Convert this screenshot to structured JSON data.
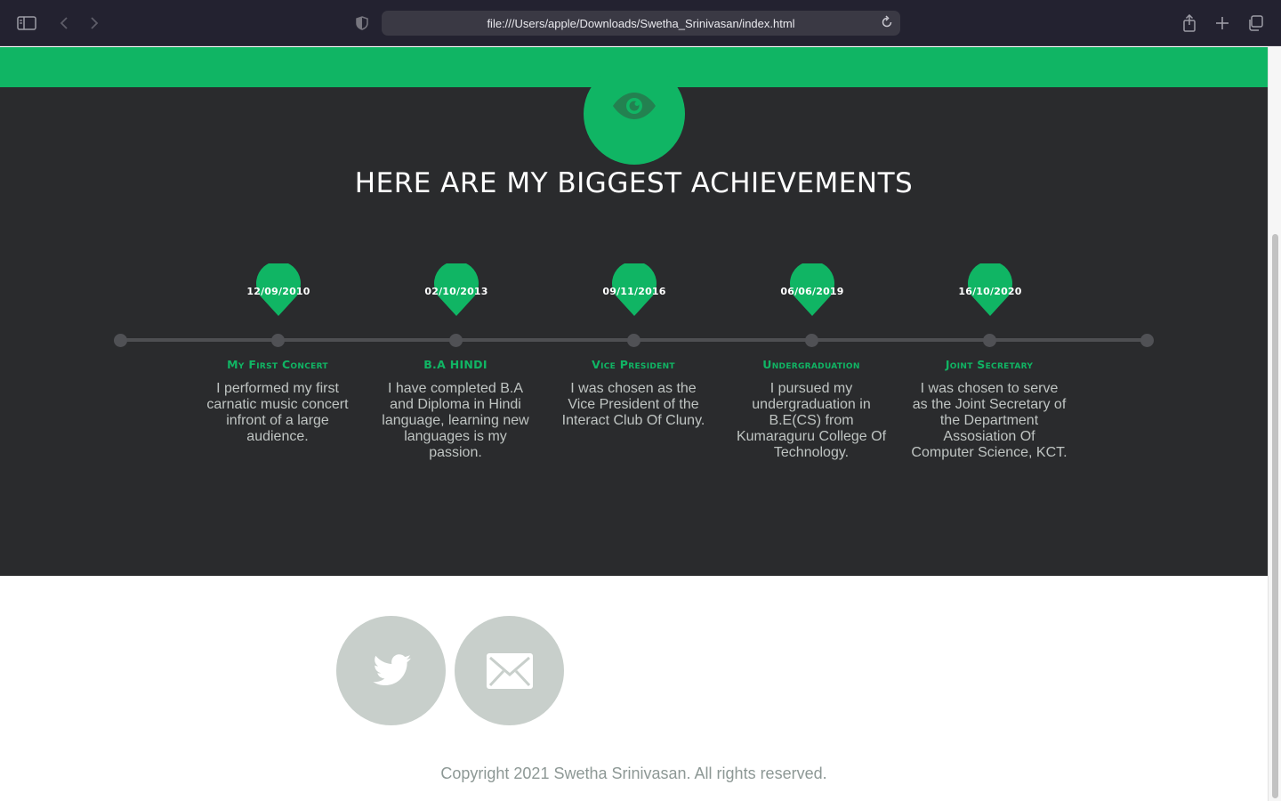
{
  "browser": {
    "url": "file:///Users/apple/Downloads/Swetha_Srinivasan/index.html",
    "icons": [
      "sidebar-icon",
      "back-icon",
      "forward-icon",
      "shield-icon",
      "reload-icon",
      "share-icon",
      "new-tab-icon",
      "tabs-overview-icon"
    ]
  },
  "colors": {
    "accent": "#10b564",
    "dark_bg": "#2a2b2d",
    "social_bg": "#c8cfcb"
  },
  "achievements": {
    "heading": "HERE ARE MY BIGGEST ACHIEVEMENTS",
    "icon": "eye-icon",
    "items": [
      {
        "date": "12/09/2010",
        "title": "My First Concert",
        "description": "I performed my first carnatic music concert infront of a large audience."
      },
      {
        "date": "02/10/2013",
        "title": "B.A HINDI",
        "description": "I have completed B.A and Diploma in Hindi language, learning new languages is my passion."
      },
      {
        "date": "09/11/2016",
        "title": "Vice President",
        "description": "I was chosen as the Vice President of the Interact Club Of Cluny."
      },
      {
        "date": "06/06/2019",
        "title": "Undergraduation",
        "description": "I pursued my undergraduation in B.E(CS) from Kumaraguru College Of Technology."
      },
      {
        "date": "16/10/2020",
        "title": "Joint Secretary",
        "description": "I was chosen to serve as the Joint Secretary of the Department Assosiation Of Computer Science, KCT."
      }
    ]
  },
  "footer": {
    "social": [
      {
        "name": "twitter",
        "icon": "twitter-icon"
      },
      {
        "name": "email",
        "icon": "mail-icon"
      }
    ],
    "copyright": "Copyright 2021 Swetha Srinivasan. All rights reserved."
  }
}
